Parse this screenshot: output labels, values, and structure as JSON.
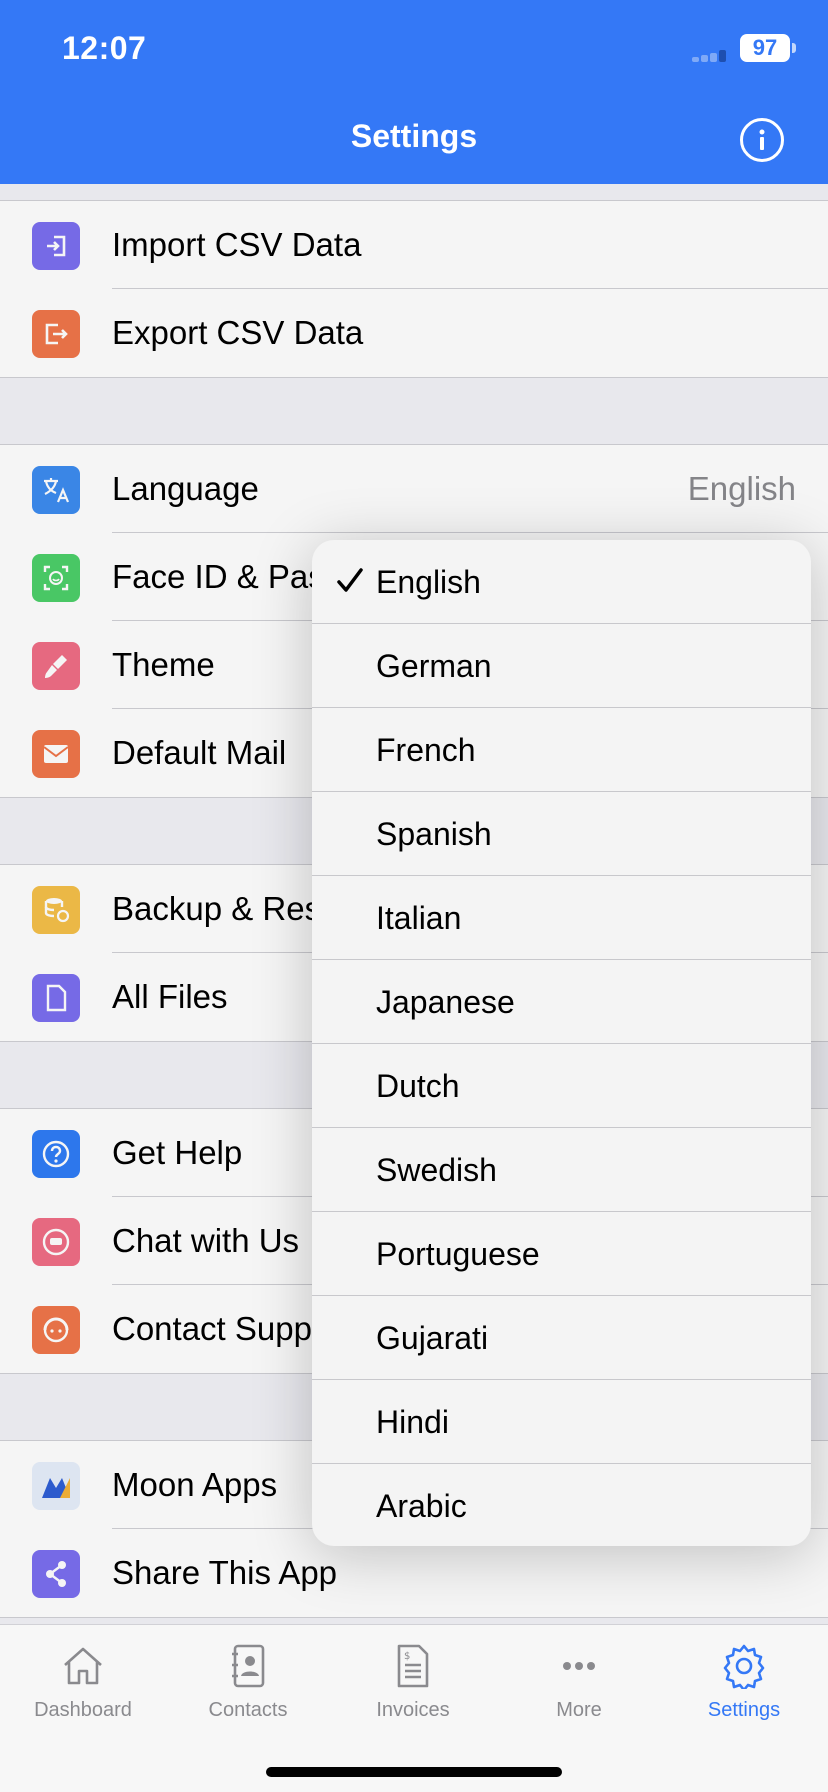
{
  "status_bar": {
    "time": "12:07",
    "battery": "97"
  },
  "nav": {
    "title": "Settings",
    "info_icon": "info-circle-icon"
  },
  "groups": [
    {
      "rows": [
        {
          "label": "Import CSV Data",
          "icon": "import-icon",
          "color": "#7b6ff0"
        },
        {
          "label": "Export CSV Data",
          "icon": "export-icon",
          "color": "#f0764a"
        }
      ]
    },
    {
      "rows": [
        {
          "label": "Language",
          "value": "English",
          "icon": "translate-icon",
          "color": "#3d8cf0"
        },
        {
          "label": "Face ID & Pas",
          "icon": "face-id-icon",
          "color": "#4cd06a"
        },
        {
          "label": "Theme",
          "icon": "brush-icon",
          "color": "#f06e86"
        },
        {
          "label": "Default Mail",
          "icon": "mail-icon",
          "color": "#f0764a"
        }
      ]
    },
    {
      "rows": [
        {
          "label": "Backup & Res",
          "icon": "database-icon",
          "color": "#f5c049"
        },
        {
          "label": "All Files",
          "icon": "file-icon",
          "color": "#7b6ff0"
        }
      ]
    },
    {
      "rows": [
        {
          "label": "Get Help",
          "icon": "help-icon",
          "color": "#2f7cf6"
        },
        {
          "label": "Chat with Us",
          "icon": "chat-icon",
          "color": "#f06e86"
        },
        {
          "label": "Contact Supp",
          "icon": "support-icon",
          "color": "#f0764a"
        }
      ]
    },
    {
      "rows": [
        {
          "label": "Moon Apps",
          "icon": "moon-apps-logo",
          "color": "#e6effb"
        },
        {
          "label": "Share This App",
          "icon": "share-icon",
          "color": "#7b6ff0"
        }
      ]
    }
  ],
  "language_menu": {
    "selected": "English",
    "options": [
      "English",
      "German",
      "French",
      "Spanish",
      "Italian",
      "Japanese",
      "Dutch",
      "Swedish",
      "Portuguese",
      "Gujarati",
      "Hindi",
      "Arabic"
    ]
  },
  "tabbar": {
    "tabs": [
      {
        "label": "Dashboard",
        "icon": "house-icon"
      },
      {
        "label": "Contacts",
        "icon": "contacts-book-icon"
      },
      {
        "label": "Invoices",
        "icon": "invoice-icon"
      },
      {
        "label": "More",
        "icon": "ellipsis-icon"
      },
      {
        "label": "Settings",
        "icon": "gear-icon",
        "active": true
      }
    ]
  },
  "colors": {
    "accent": "#3478f6",
    "inactive_tab": "#8a8a8e"
  }
}
